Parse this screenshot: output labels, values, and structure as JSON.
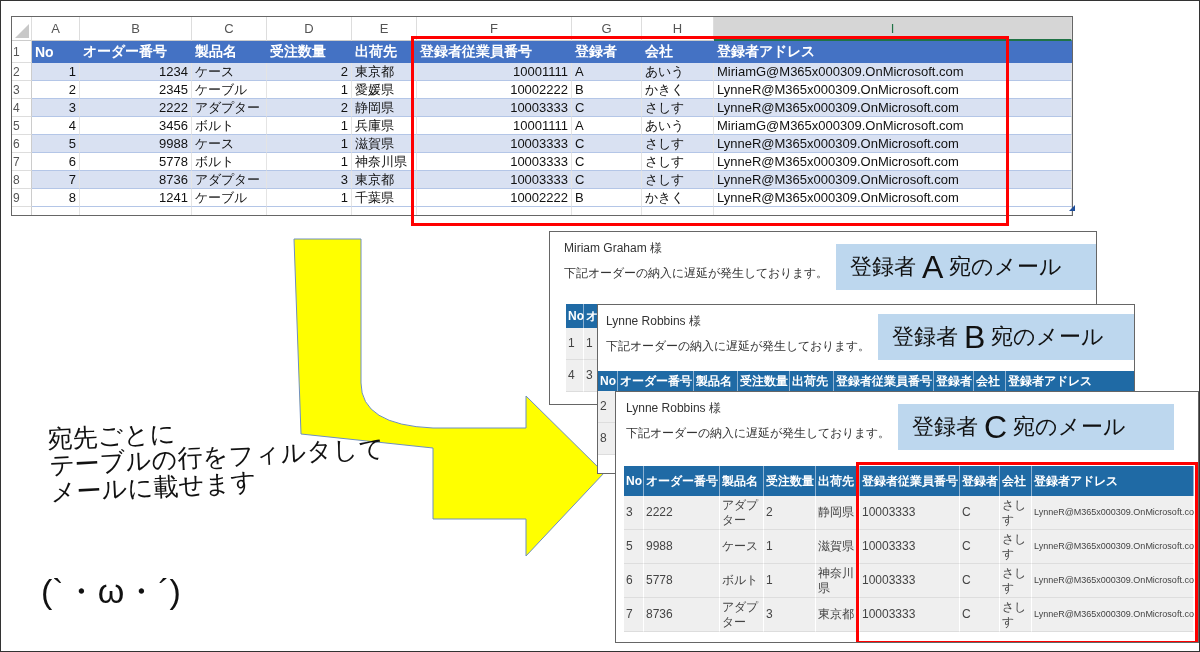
{
  "spreadsheet": {
    "column_letters": [
      {
        "label": "A",
        "selected": false
      },
      {
        "label": "B",
        "selected": false
      },
      {
        "label": "C",
        "selected": false
      },
      {
        "label": "D",
        "selected": false
      },
      {
        "label": "E",
        "selected": false
      },
      {
        "label": "F",
        "selected": false
      },
      {
        "label": "G",
        "selected": false
      },
      {
        "label": "H",
        "selected": false
      },
      {
        "label": "I",
        "selected": true
      }
    ],
    "row_numbers": [
      "1",
      "2",
      "3",
      "4",
      "5",
      "6",
      "7",
      "8",
      "9"
    ],
    "columns": [
      {
        "label": "No",
        "kind": "number"
      },
      {
        "label": "オーダー番号",
        "kind": "number"
      },
      {
        "label": "製品名",
        "kind": "text"
      },
      {
        "label": "受注数量",
        "kind": "number"
      },
      {
        "label": "出荷先",
        "kind": "text"
      },
      {
        "label": "登録者従業員番号",
        "kind": "number"
      },
      {
        "label": "登録者",
        "kind": "text"
      },
      {
        "label": "会社",
        "kind": "text"
      },
      {
        "label": "登録者アドレス",
        "kind": "text"
      }
    ],
    "rows": [
      [
        "1",
        "1234",
        "ケース",
        "2",
        "東京都",
        "10001111",
        "A",
        "あいう",
        "MiriamG@M365x000309.OnMicrosoft.com"
      ],
      [
        "2",
        "2345",
        "ケーブル",
        "1",
        "愛媛県",
        "10002222",
        "B",
        "かきく",
        "LynneR@M365x000309.OnMicrosoft.com"
      ],
      [
        "3",
        "2222",
        "アダプター",
        "2",
        "静岡県",
        "10003333",
        "C",
        "さしす",
        "LynneR@M365x000309.OnMicrosoft.com"
      ],
      [
        "4",
        "3456",
        "ボルト",
        "1",
        "兵庫県",
        "10001111",
        "A",
        "あいう",
        "MiriamG@M365x000309.OnMicrosoft.com"
      ],
      [
        "5",
        "9988",
        "ケース",
        "1",
        "滋賀県",
        "10003333",
        "C",
        "さしす",
        "LynneR@M365x000309.OnMicrosoft.com"
      ],
      [
        "6",
        "5778",
        "ボルト",
        "1",
        "神奈川県",
        "10003333",
        "C",
        "さしす",
        "LynneR@M365x000309.OnMicrosoft.com"
      ],
      [
        "7",
        "8736",
        "アダプター",
        "3",
        "東京都",
        "10003333",
        "C",
        "さしす",
        "LynneR@M365x000309.OnMicrosoft.com"
      ],
      [
        "8",
        "1241",
        "ケーブル",
        "1",
        "千葉県",
        "10002222",
        "B",
        "かきく",
        "LynneR@M365x000309.OnMicrosoft.com"
      ]
    ]
  },
  "emails": [
    {
      "recipient": "Miriam Graham 様",
      "message": "下記オーダーの納入に遅延が発生しております。",
      "label": {
        "prefix": "登録者",
        "letter": "A",
        "suffix": "宛のメール"
      },
      "columns": [
        "No",
        "オ"
      ],
      "rows": [
        [
          "1",
          "1"
        ],
        [
          "4",
          "3"
        ]
      ],
      "highlighted": false
    },
    {
      "recipient": "Lynne Robbins 様",
      "message": "下記オーダーの納入に遅延が発生しております。",
      "label": {
        "prefix": "登録者",
        "letter": "B",
        "suffix": "宛のメール"
      },
      "columns": [
        "No",
        "オーダー番号",
        "製品名",
        "受注数量",
        "出荷先",
        "登録者従業員番号",
        "登録者",
        "会社",
        "登録者アドレス"
      ],
      "rows": [
        [
          "2"
        ],
        [
          "8"
        ]
      ],
      "highlighted": false
    },
    {
      "recipient": "Lynne Robbins 様",
      "message": "下記オーダーの納入に遅延が発生しております。",
      "label": {
        "prefix": "登録者",
        "letter": "C",
        "suffix": "宛のメール"
      },
      "columns": [
        "No",
        "オーダー番号",
        "製品名",
        "受注数量",
        "出荷先",
        "登録者従業員番号",
        "登録者",
        "会社",
        "登録者アドレス"
      ],
      "rows": [
        [
          "3",
          "2222",
          "アダプター",
          "2",
          "静岡県",
          "10003333",
          "C",
          "さしす",
          "LynneR@M365x000309.OnMicrosoft.co"
        ],
        [
          "5",
          "9988",
          "ケース",
          "1",
          "滋賀県",
          "10003333",
          "C",
          "さしす",
          "LynneR@M365x000309.OnMicrosoft.co"
        ],
        [
          "6",
          "5778",
          "ボルト",
          "1",
          "神奈川県",
          "10003333",
          "C",
          "さしす",
          "LynneR@M365x000309.OnMicrosoft.co"
        ],
        [
          "7",
          "8736",
          "アダプター",
          "3",
          "東京都",
          "10003333",
          "C",
          "さしす",
          "LynneR@M365x000309.OnMicrosoft.co"
        ]
      ],
      "highlighted": true
    }
  ],
  "caption": [
    "宛先ごとに",
    "テーブルの行をフィルタして",
    "メールに載せます"
  ],
  "kaomoji": "(`・ω・´)"
}
